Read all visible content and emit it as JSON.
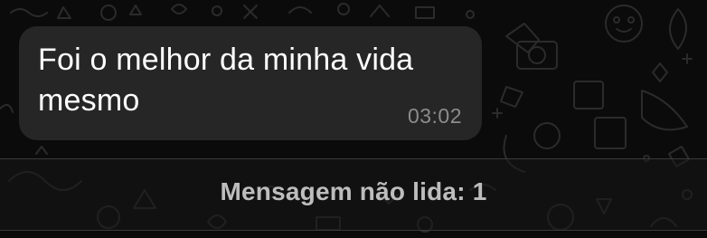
{
  "message": {
    "text": "Foi o melhor da minha vida mesmo",
    "time": "03:02"
  },
  "unread_banner": {
    "label": "Mensagem não lida: 1"
  },
  "colors": {
    "background": "#0b0b0b",
    "bubble": "#262626",
    "message_text": "#ffffff",
    "timestamp": "#8c8c8c",
    "banner_text": "#bdbdbd"
  }
}
